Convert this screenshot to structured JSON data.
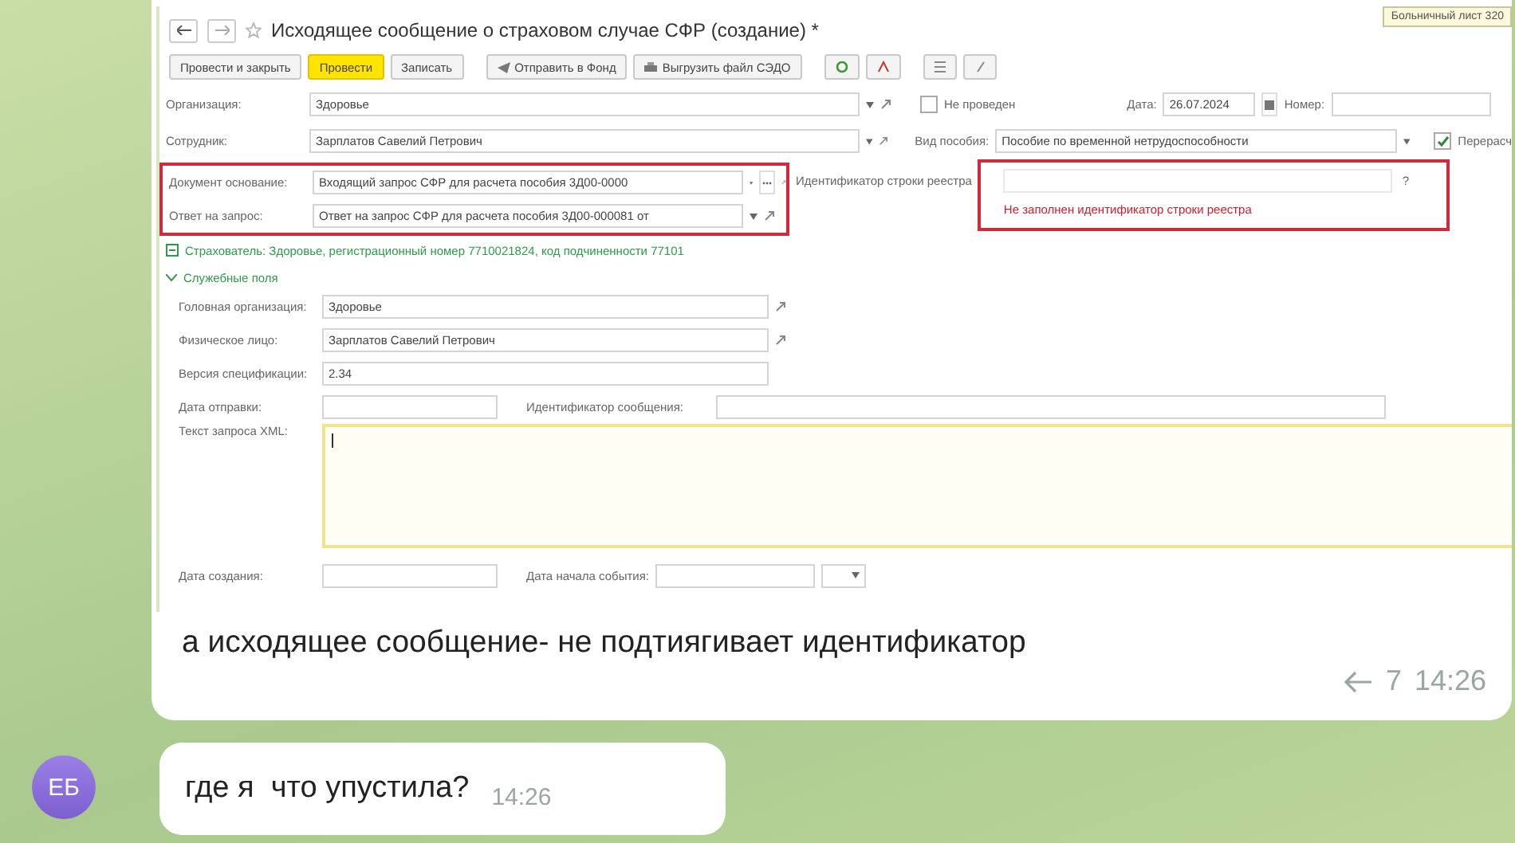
{
  "tooltip": "Больничный лист 320",
  "form": {
    "title": "Исходящее сообщение о страховом случае СФР (создание) *",
    "toolbar": [
      {
        "label": "Провести и закрыть",
        "kind": "text",
        "primary": false
      },
      {
        "label": "Провести",
        "kind": "text",
        "primary": true
      },
      {
        "label": "Записать",
        "kind": "text",
        "primary": false
      },
      {
        "label": "Отправить в Фонд",
        "kind": "send",
        "primary": false
      },
      {
        "label": "Выгрузить файл СЭДО",
        "kind": "export",
        "primary": false
      }
    ],
    "organization": {
      "label": "Организация:",
      "value": "Здоровье"
    },
    "not_posted": {
      "label": "Не проведен",
      "checked": false
    },
    "date": {
      "label": "Дата:",
      "value": "26.07.2024"
    },
    "number": {
      "label": "Номер:"
    },
    "employee": {
      "label": "Сотрудник:",
      "value": "Зарплатов Савелий Петрович"
    },
    "benefit_type": {
      "label": "Вид пособия:",
      "value": "Пособие по временной нетрудоспособности"
    },
    "recalc": {
      "label": "Перерасч",
      "checked": true
    },
    "base_document": {
      "label": "Документ основание:",
      "value": "Входящий запрос СФР для расчета пособия 3Д00-0000"
    },
    "answer": {
      "label": "Ответ на запрос:",
      "value": "Ответ на запрос СФР для расчета пособия 3Д00-000081 от"
    },
    "register_id": {
      "label": "Идентификатор строки реестра",
      "help": "?",
      "error": "Не заполнен идентификатор строки реестра"
    },
    "insurer": "Страхователь: Здоровье, регистрационный номер 7710021824, код подчиненности 77101",
    "service_section": {
      "label": "Служебные поля",
      "expanded": true
    },
    "service_fields": [
      {
        "label": "Головная организация:",
        "value": "Здоровье"
      },
      {
        "label": "Физическое лицо:",
        "value": "Зарплатов Савелий Петрович"
      },
      {
        "label": "Версия спецификации:",
        "value": "2.34"
      }
    ],
    "send_date": {
      "label": "Дата отправки:"
    },
    "message_id": {
      "label": "Идентификатор сообщения:"
    },
    "xml": {
      "label": "Текст запроса XML:"
    },
    "created": {
      "label": "Дата создания:"
    },
    "event_start": {
      "label": "Дата начала события:"
    }
  },
  "messages": [
    {
      "caption": "а исходящее сообщение- не подтиягивает идентификатор",
      "replies": "7",
      "time": "14:26"
    },
    {
      "avatar": "ЕБ",
      "text": "где я  что упустила?",
      "time": "14:26"
    }
  ]
}
